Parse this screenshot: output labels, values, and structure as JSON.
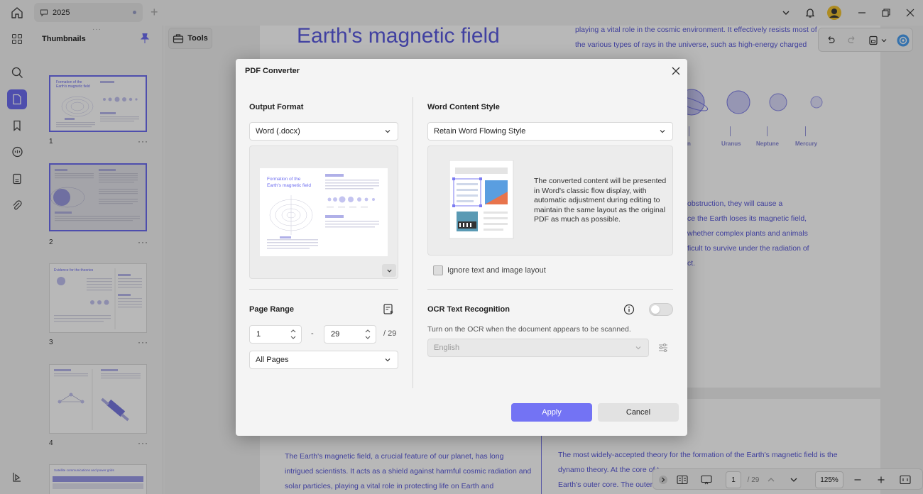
{
  "titlebar": {
    "tab_label": "2025",
    "new_tab": "+"
  },
  "thumbnails": {
    "title": "Thumbnails",
    "pages": [
      {
        "number": "1",
        "more": "···"
      },
      {
        "number": "2",
        "more": "···"
      },
      {
        "number": "3",
        "more": "···"
      },
      {
        "number": "4",
        "more": "···"
      }
    ]
  },
  "tools": {
    "label": "Tools"
  },
  "document": {
    "title": "Earth's magnetic field",
    "right_intro": [
      "playing a vital role in the cosmic environment. It effectively resists most of",
      "the various types of rays in the universe, such as high-energy charged"
    ],
    "planets": [
      "Uranus",
      "Neptune",
      "Mercury"
    ],
    "planet_partial": "urn",
    "right_mid": [
      "obstruction, they will cause a",
      "ce the Earth loses its magnetic field,",
      " whether complex plants and animals",
      "ficult to survive under the radiation of",
      "ct."
    ],
    "bottom_left": [
      "The Earth's magnetic field, a crucial feature of our planet, has long",
      "intrigued scientists. It acts as a shield against harmful cosmic radiation and",
      " solar particles, playing a vital role in protecting life on Earth and"
    ],
    "bottom_right": [
      "The most widely-accepted theory for the formation of the Earth's magnetic field is the",
      "dynamo theory. At the core of t",
      "Earth's outer core. The outer c"
    ]
  },
  "statusbar": {
    "page_current": "1",
    "page_total": "/ 29",
    "zoom": "125%"
  },
  "dialog": {
    "title": "PDF Converter",
    "output_format_label": "Output Format",
    "output_format_value": "Word (.docx)",
    "word_style_label": "Word Content Style",
    "word_style_value": "Retain Word Flowing Style",
    "style_description": "The converted content will be presented in Word's classic flow display, with automatic adjustment during editing to maintain the same layout as the original PDF as much as possible.",
    "ignore_layout_label": "Ignore text and image layout",
    "page_range_label": "Page Range",
    "range_from": "1",
    "range_separator": "-",
    "range_to": "29",
    "range_total": "/ 29",
    "range_mode": "All Pages",
    "ocr_label": "OCR Text Recognition",
    "ocr_hint": "Turn on the OCR when the document appears to be scanned.",
    "ocr_language": "English",
    "apply_label": "Apply",
    "cancel_label": "Cancel",
    "preview": {
      "title_line1": "Formation of the",
      "title_line2": "Earth's magnetic field"
    }
  },
  "thumb_text": {
    "p1_title": "Formation of the",
    "p1_title2": "Earth's magnetic field",
    "p3_title": "Evidence for the theories",
    "p5_title": "Satellite communications and power grids"
  },
  "colors": {
    "accent": "#6d6df0",
    "doc_text": "#5858d8",
    "apply": "#7373f4"
  }
}
